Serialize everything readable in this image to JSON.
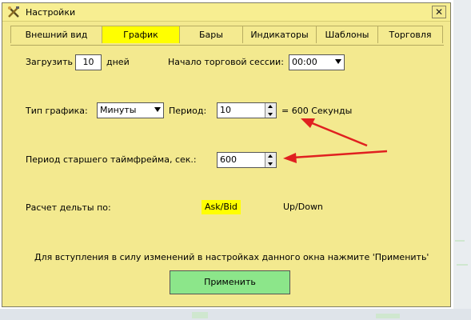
{
  "window": {
    "title": "Настройки",
    "close_glyph": "✕"
  },
  "tabs": [
    {
      "label": "Внешний вид",
      "active": false
    },
    {
      "label": "График",
      "active": true
    },
    {
      "label": "Бары",
      "active": false
    },
    {
      "label": "Индикаторы",
      "active": false
    },
    {
      "label": "Шаблоны",
      "active": false
    },
    {
      "label": "Торговля",
      "active": false
    }
  ],
  "load": {
    "label": "Загрузить",
    "value": "10",
    "unit": "дней"
  },
  "session": {
    "label": "Начало торговой сессии:",
    "value": "00:00"
  },
  "chart_type": {
    "label": "Тип графика:",
    "value": "Минуты"
  },
  "period": {
    "label": "Период:",
    "value": "10",
    "equivalent": "= 600 Секунды"
  },
  "senior_period": {
    "label": "Период старшего таймфрейма, сек.:",
    "value": "600"
  },
  "delta": {
    "label": "Расчет дельты по:",
    "options": [
      {
        "label": "Ask/Bid",
        "selected": true
      },
      {
        "label": "Up/Down",
        "selected": false
      }
    ]
  },
  "notice": "Для вступления в силу изменений в настройках данного окна нажмите 'Применить'",
  "apply_label": "Применить",
  "colors": {
    "window_bg": "#f3e98f",
    "active_tab": "#ffff00",
    "apply_button": "#8ce68a",
    "annotation_arrow": "#e02020"
  }
}
